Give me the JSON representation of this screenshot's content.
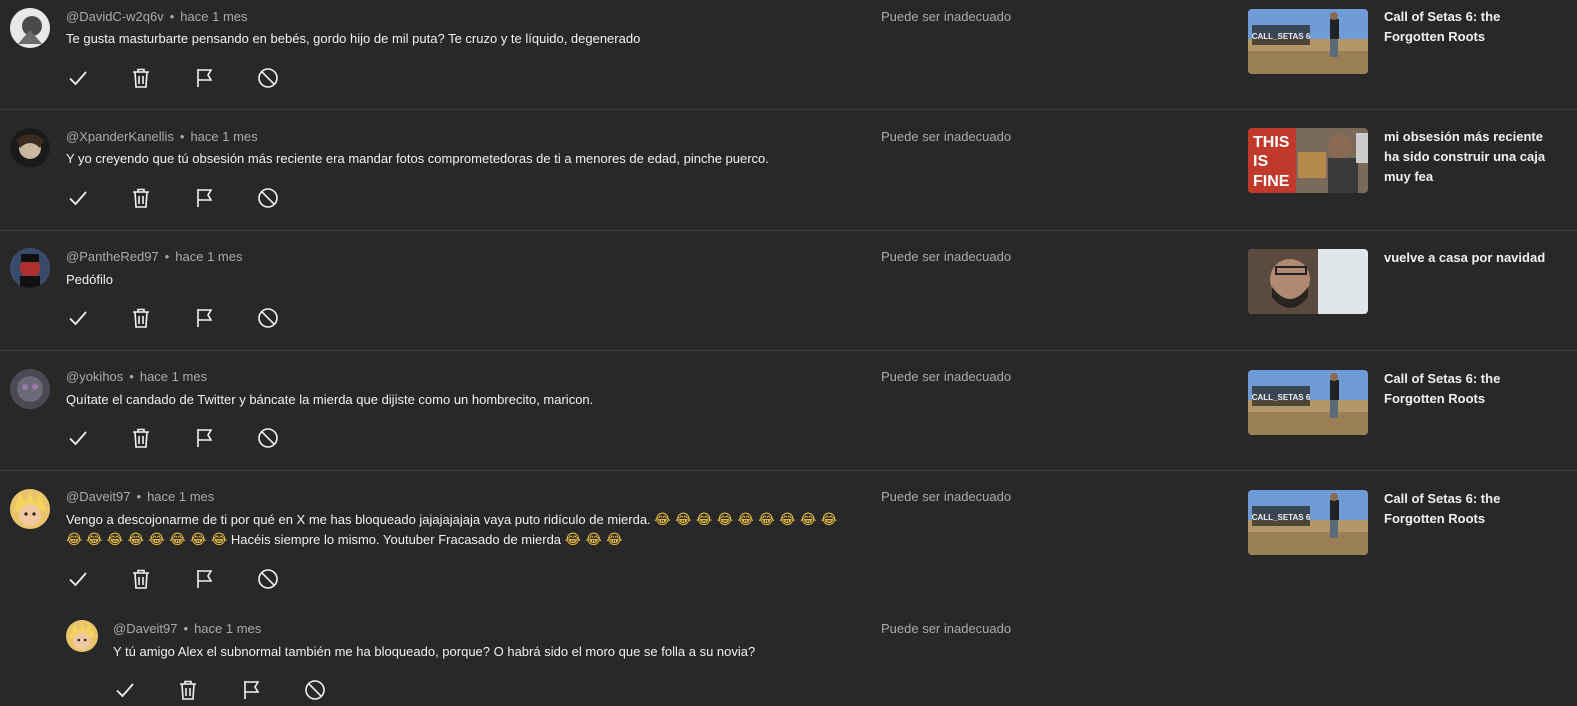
{
  "labels": {
    "status": "Puede ser inadecuado",
    "dot": "•"
  },
  "comments": [
    {
      "author": "@DavidC-w2q6v",
      "time": "hace 1 mes",
      "text": "Te gusta masturbarte pensando en bebés, gordo hijo de mil puta? Te cruzo y te líquido, degenerado",
      "video_title": "Call of Setas 6: the Forgotten Roots"
    },
    {
      "author": "@XpanderKanellis",
      "time": "hace 1 mes",
      "text": "Y yo creyendo que tú obsesión más reciente era mandar fotos comprometedoras de ti a menores de edad, pinche puerco.",
      "video_title": "mi obsesión más reciente ha sido construir una caja muy fea"
    },
    {
      "author": "@PantheRed97",
      "time": "hace 1 mes",
      "text": "Pedófilo",
      "video_title": "vuelve a casa por navidad"
    },
    {
      "author": "@yokihos",
      "time": "hace 1 mes",
      "text": "Quítate el candado de Twitter y báncate la mierda que dijiste como un hombrecito, maricon.",
      "video_title": "Call of Setas 6: the Forgotten Roots"
    },
    {
      "author": "@Daveit97",
      "time": "hace 1 mes",
      "text_line1": "Vengo a descojonarme de ti por qué en X me has bloqueado jajajajajaja vaya puto ridículo de mierda.",
      "emoji_run1": "😂 😂 😂 😂 😂 😂 😂 😂 😂 😂",
      "emoji_run2": "😂 😂 😂 😂 😂 😂 😂",
      "text_line2": "Hacéis siempre lo mismo. Youtuber Fracasado de mierda",
      "emoji_run3": "😂 😂 😂",
      "video_title": "Call of Setas 6: the Forgotten Roots"
    },
    {
      "author": "@Daveit97",
      "time": "hace 1 mes",
      "text": "Y tú amigo Alex el subnormal también me ha bloqueado, porque? O habrá sido el moro que se folla a su novia?"
    }
  ],
  "thumbnail_texts": {
    "call_of_setas": "CALL_SETAS 6",
    "this_is_fine": [
      "THIS",
      "IS",
      "FINE"
    ]
  },
  "colors": {
    "background": "#282828",
    "text_primary": "#f1f1f1",
    "text_secondary": "#aaaaaa",
    "divider": "#3d3d3d"
  }
}
